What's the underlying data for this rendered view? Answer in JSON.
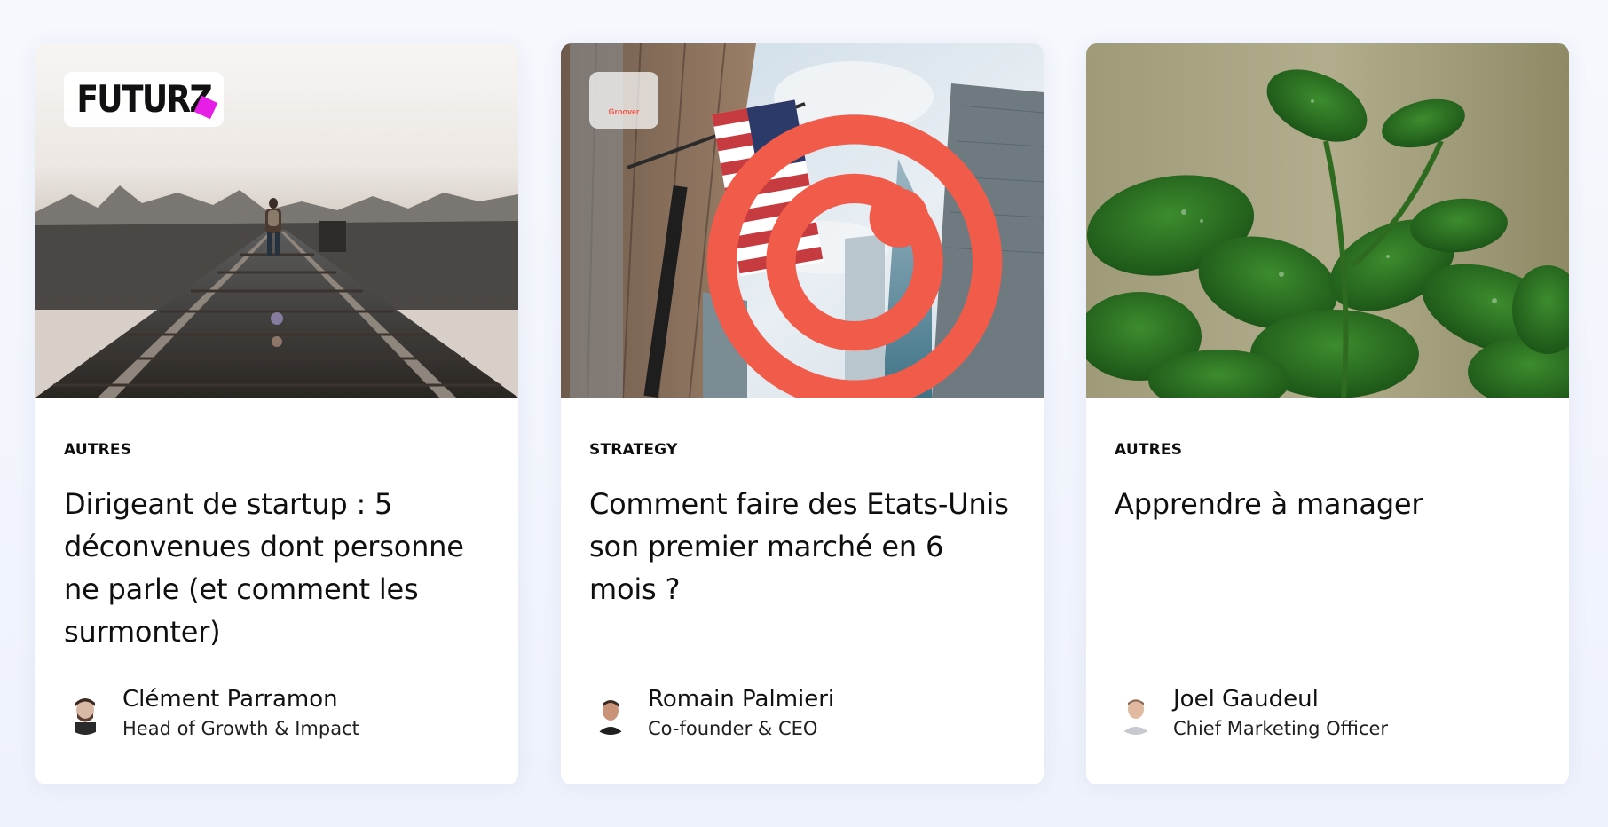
{
  "cards": [
    {
      "category": "AUTRES",
      "title": "Dirigeant de startup : 5 déconvenues dont personne ne parle (et comment les surmonter)",
      "author_name": "Clément Parramon",
      "author_role": "Head of Growth & Impact",
      "image_subject": "person walking on railway tracks",
      "company_logo": "FUTURZ",
      "avatar_tone": "#8c6b52"
    },
    {
      "category": "STRATEGY",
      "title": "Comment faire des Etats-Unis son premier marché en 6 mois ?",
      "author_name": "Romain Palmieri",
      "author_role": "Co-founder & CEO",
      "image_subject": "american flag among skyscrapers",
      "company_logo": "Groover",
      "avatar_tone": "#a47a63"
    },
    {
      "category": "AUTRES",
      "title": "Apprendre à manager",
      "author_name": "Joel Gaudeul",
      "author_role": "Chief Marketing Officer",
      "image_subject": "green plant leaves with water drops",
      "company_logo": "",
      "avatar_tone": "#c9a189"
    }
  ],
  "colors": {
    "accent_magenta": "#e61ee6",
    "groover_coral": "#f15b4a",
    "page_background": "#f3f6fc"
  },
  "icons": {
    "logo_1": "futurz-logo",
    "logo_2": "groover-logo"
  }
}
